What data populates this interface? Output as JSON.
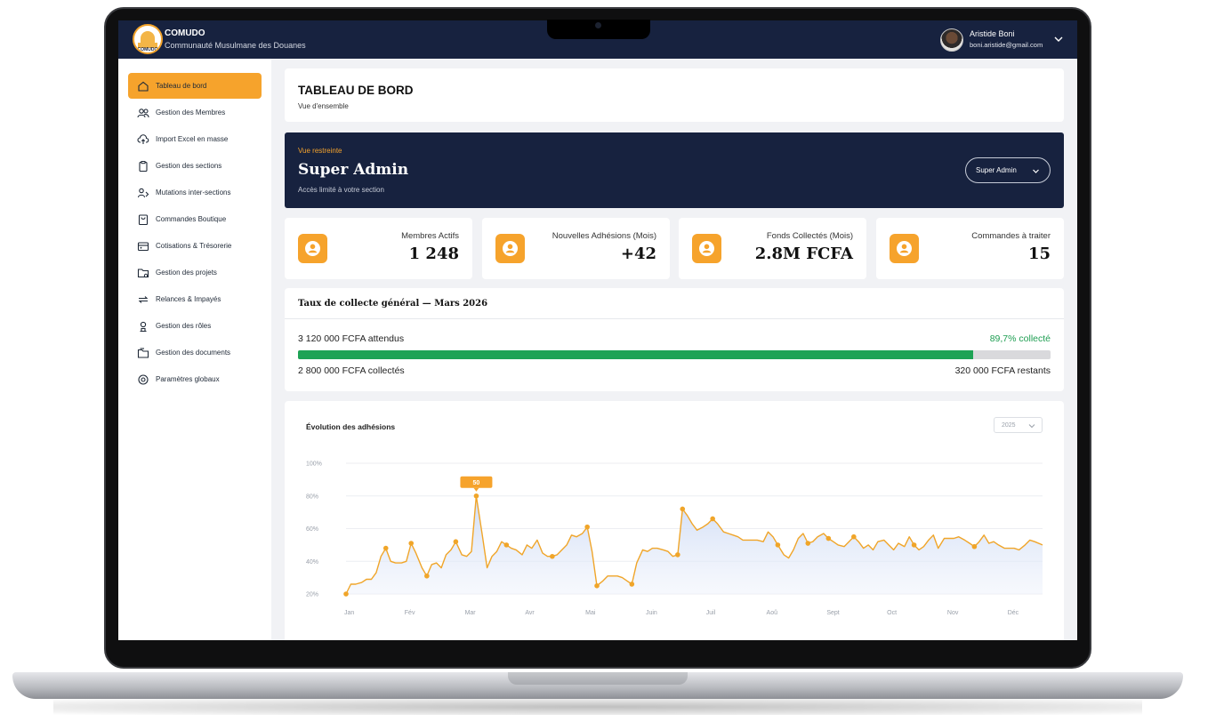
{
  "brand": {
    "name": "COMUDO",
    "subtitle": "Communauté Musulmane des Douanes",
    "logo_text": "COMUDO"
  },
  "user": {
    "name": "Aristide Boni",
    "email": "boni.aristide@gmail.com"
  },
  "sidebar": {
    "items": [
      {
        "label": "Tableau de bord",
        "icon": "home-icon",
        "active": true
      },
      {
        "label": "Gestion des Membres",
        "icon": "users-icon"
      },
      {
        "label": "Import Excel en masse",
        "icon": "cloud-upload-icon"
      },
      {
        "label": "Gestion des sections",
        "icon": "clipboard-icon"
      },
      {
        "label": "Mutations inter-sections",
        "icon": "user-transfer-icon"
      },
      {
        "label": "Commandes Boutique",
        "icon": "shop-order-icon"
      },
      {
        "label": "Cotisations & Trésorerie",
        "icon": "wallet-icon"
      },
      {
        "label": "Gestion des projets",
        "icon": "folder-gear-icon"
      },
      {
        "label": "Relances & Impayés",
        "icon": "refresh-icon"
      },
      {
        "label": "Gestion des rôles",
        "icon": "role-icon"
      },
      {
        "label": "Gestion des documents",
        "icon": "documents-icon"
      },
      {
        "label": "Paramètres globaux",
        "icon": "settings-icon"
      }
    ]
  },
  "header": {
    "title": "TABLEAU DE BORD",
    "subtitle": "Vue d'ensemble"
  },
  "banner": {
    "tag": "Vue restreinte",
    "title": "Super Admin",
    "subtitle": "Accès limité à votre section",
    "role_selected": "Super Admin"
  },
  "stats": [
    {
      "label": "Membres Actifs",
      "value": "1 248",
      "icon": "user-icon"
    },
    {
      "label": "Nouvelles Adhésions (Mois)",
      "value": "+42",
      "icon": "user-icon"
    },
    {
      "label": "Fonds Collectés (Mois)",
      "value": "2.8M FCFA",
      "icon": "user-icon"
    },
    {
      "label": "Commandes à traiter",
      "value": "15",
      "icon": "user-icon"
    }
  ],
  "collection": {
    "title": "Taux de collecte général — Mars 2026",
    "expected": "3 120 000 FCFA attendus",
    "percent_label": "89,7% collecté",
    "percent": 89.7,
    "collected": "2 800 000 FCFA collectés",
    "remaining": "320 000 FCFA restants"
  },
  "colors": {
    "navy": "#17223f",
    "accent": "#f6a32c",
    "success": "#1ea355",
    "line": "#f0a529"
  },
  "chart_data": {
    "type": "line",
    "title": "Évolution des adhésions",
    "year_selected": "2025",
    "y_ticks": [
      "100%",
      "80%",
      "60%",
      "40%",
      "20%"
    ],
    "ylim": [
      20,
      100
    ],
    "x_ticks": [
      "Jan",
      "Fév",
      "Mar",
      "Avr",
      "Mai",
      "Juin",
      "Juil",
      "Aoû",
      "Sept",
      "Oct",
      "Nov",
      "Déc"
    ],
    "tooltip": {
      "label": "50"
    },
    "grid": true,
    "x": [
      0,
      0.08,
      0.16,
      0.26,
      0.34,
      0.42,
      0.5,
      0.58,
      0.66,
      0.74,
      0.82,
      0.92,
      1.0,
      1.08,
      1.16,
      1.26,
      1.34,
      1.42,
      1.5,
      1.58,
      1.66,
      1.74,
      1.82,
      1.92,
      2.0,
      2.08,
      2.16,
      2.26,
      2.34,
      2.42,
      2.5,
      2.58,
      2.66,
      2.74,
      2.82,
      2.92,
      3.0,
      3.08,
      3.17,
      3.26,
      3.34,
      3.42,
      3.5,
      3.58,
      3.66,
      3.74,
      3.82,
      3.92,
      4.0,
      4.08,
      4.16,
      4.26,
      4.34,
      4.42,
      4.5,
      4.58,
      4.66,
      4.74,
      4.82,
      4.92,
      5.0,
      5.08,
      5.16,
      5.26,
      5.34,
      5.42,
      5.5,
      5.58,
      5.66,
      5.74,
      5.82,
      5.92,
      6.0,
      6.08,
      6.16,
      6.26,
      6.34,
      6.42,
      6.5,
      6.58,
      6.66,
      6.74,
      6.82,
      6.92,
      7.0,
      7.08,
      7.16,
      7.26,
      7.34,
      7.42,
      7.5,
      7.58,
      7.66,
      7.74,
      7.82,
      7.92,
      8.0,
      8.08,
      8.16,
      8.26,
      8.34,
      8.42,
      8.5,
      8.58,
      8.66,
      8.74,
      8.82,
      8.92,
      9.0,
      9.08,
      9.16,
      9.26,
      9.34,
      9.42,
      9.5,
      9.58,
      9.66,
      9.74,
      9.82,
      9.92,
      10.0,
      10.08,
      10.16,
      10.26,
      10.34,
      10.42,
      10.5,
      10.58,
      10.66,
      10.74,
      10.82,
      10.92,
      11.0,
      11.08,
      11.16,
      11.26,
      11.34,
      11.42,
      11.55
    ],
    "series": [
      {
        "values": [
          20,
          26,
          26,
          27,
          29,
          29,
          33,
          43,
          48,
          40,
          39,
          39,
          40,
          51,
          45,
          36,
          31,
          38,
          39,
          36,
          44,
          47,
          52,
          44,
          43,
          46,
          80,
          56,
          36,
          43,
          46,
          52,
          50,
          48,
          47,
          44,
          50,
          48,
          53,
          45,
          43,
          43,
          44,
          47,
          50,
          56,
          55,
          57,
          61,
          46,
          25,
          28,
          31,
          31,
          31,
          30,
          28,
          26,
          39,
          47,
          46,
          48,
          48,
          47,
          46,
          43,
          44,
          72,
          68,
          63,
          59,
          61,
          63,
          66,
          63,
          58,
          57,
          56,
          55,
          53,
          53,
          53,
          53,
          52,
          58,
          55,
          50,
          44,
          42,
          47,
          54,
          57,
          51,
          52,
          55,
          57,
          54,
          52,
          50,
          49,
          52,
          55,
          52,
          48,
          50,
          47,
          52,
          53,
          50,
          47,
          51,
          49,
          55,
          50,
          47,
          49,
          53,
          56,
          48,
          54,
          54,
          54,
          55,
          53,
          51,
          49,
          52,
          56,
          51,
          52,
          50,
          48,
          48,
          48,
          47,
          50,
          53,
          52,
          50
        ],
        "markers": [
          0,
          8,
          13,
          16,
          22,
          26,
          32,
          41,
          48,
          50,
          57,
          66,
          67,
          73,
          86,
          92,
          96,
          101,
          113,
          125
        ]
      }
    ]
  }
}
